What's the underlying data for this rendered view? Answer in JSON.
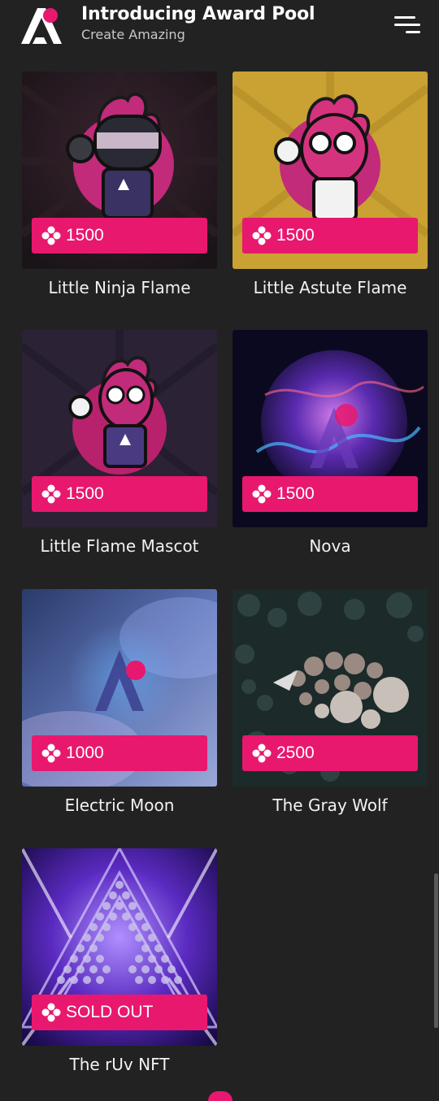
{
  "header": {
    "title": "Introducing Award Pool",
    "subtitle": "Create Amazing",
    "logo_icon": "award-pool-logo-icon",
    "menu_icon": "hamburger-menu-icon"
  },
  "colors": {
    "background": "#222222",
    "accent": "#e8186e"
  },
  "cards": [
    {
      "name": "Little Ninja Flame",
      "price": "1500",
      "icon": "token-icon"
    },
    {
      "name": "Little Astute Flame",
      "price": "1500",
      "icon": "token-icon"
    },
    {
      "name": "Little Flame Mascot",
      "price": "1500",
      "icon": "token-icon"
    },
    {
      "name": "Nova",
      "price": "1500",
      "icon": "token-icon"
    },
    {
      "name": "Electric Moon",
      "price": "1000",
      "icon": "token-icon"
    },
    {
      "name": "The Gray Wolf",
      "price": "2500",
      "icon": "token-icon"
    },
    {
      "name": "The rUv NFT",
      "price": "SOLD OUT",
      "icon": "token-icon"
    }
  ]
}
